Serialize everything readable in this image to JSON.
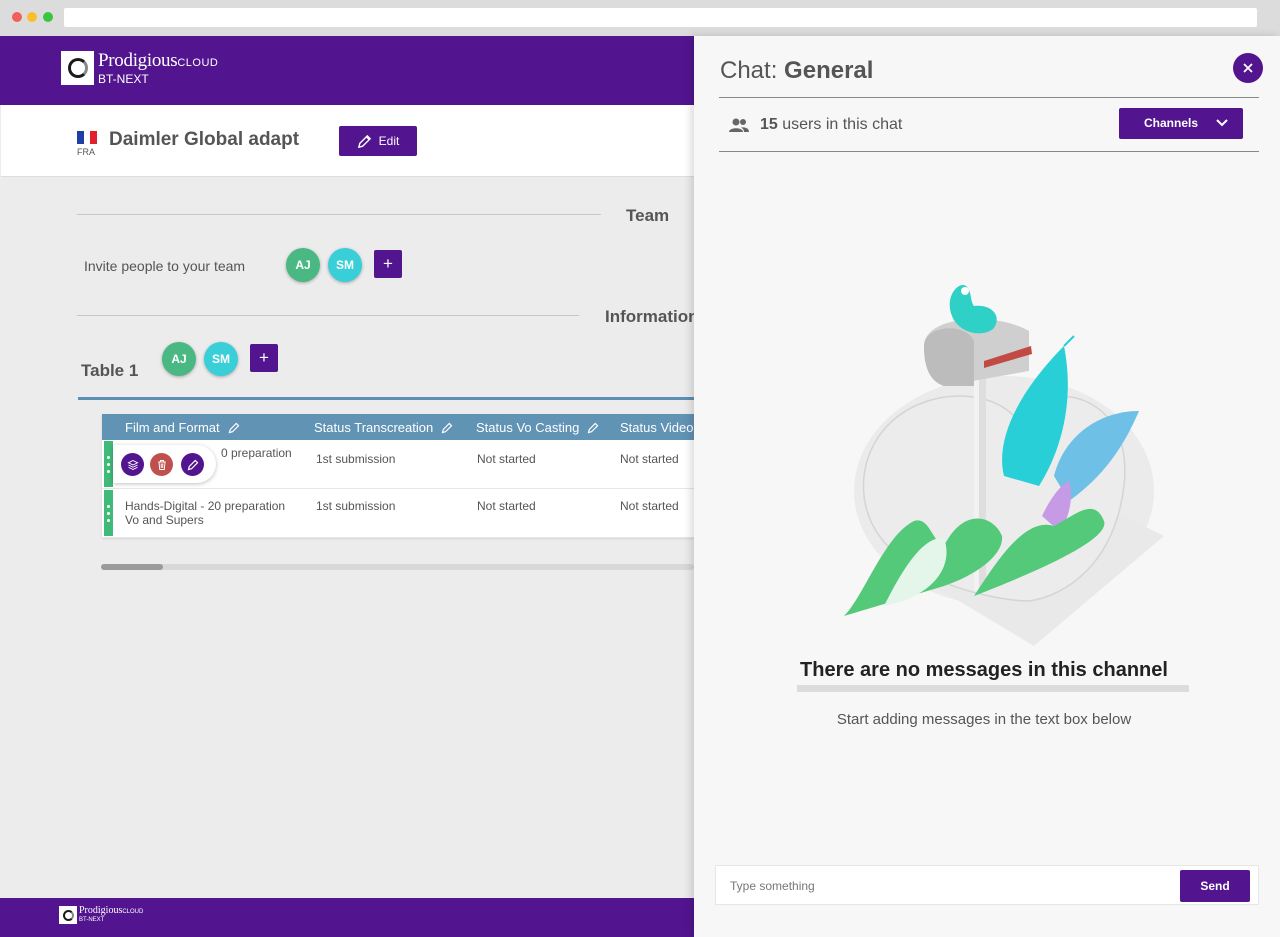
{
  "app": {
    "brand": "Prodigious",
    "brand_suffix": "CLOUD",
    "product": "BT-NEXT"
  },
  "project": {
    "flag_code": "FRA",
    "title": "Daimler Global adapt",
    "edit_label": "Edit"
  },
  "team": {
    "heading": "Team",
    "invite_label": "Invite people to your team",
    "members": [
      "AJ",
      "SM"
    ],
    "add_label": "+"
  },
  "information": {
    "heading": "Information",
    "table_title": "Table 1",
    "members": [
      "AJ",
      "SM"
    ],
    "add_label": "+",
    "columns": [
      "Film and Format",
      "Status Transcreation",
      "Status Vo Casting",
      "Status Video"
    ],
    "rows": [
      {
        "film": "0 preparation",
        "transcreation": "1st submission",
        "vo_casting": "Not started",
        "video": "Not started"
      },
      {
        "film_line1": "Hands-Digital - 20 preparation",
        "film_line2": "Vo and Supers",
        "transcreation": "1st submission",
        "vo_casting": "Not started",
        "video": "Not started"
      }
    ]
  },
  "chat": {
    "title_prefix": "Chat:",
    "channel": "General",
    "user_count": "15",
    "users_suffix": "users in this chat",
    "channels_label": "Channels",
    "empty_title": "There are no messages in this channel",
    "empty_subtitle": "Start adding messages in the text box below",
    "input_placeholder": "Type something",
    "send_label": "Send"
  },
  "colors": {
    "brand_purple": "#52158f",
    "table_header": "#6193b5",
    "row_grip_green": "#3fba78",
    "avatar_aj": "#4ab882",
    "avatar_sm": "#38cfd9",
    "delete_red": "#c0504d"
  },
  "icons": {
    "edit": "pencil-icon",
    "close": "close-icon",
    "users": "group-icon",
    "channels": "chevron-down-icon",
    "row_copy": "layers-icon",
    "row_delete": "trash-icon",
    "row_edit": "pencil-icon"
  }
}
